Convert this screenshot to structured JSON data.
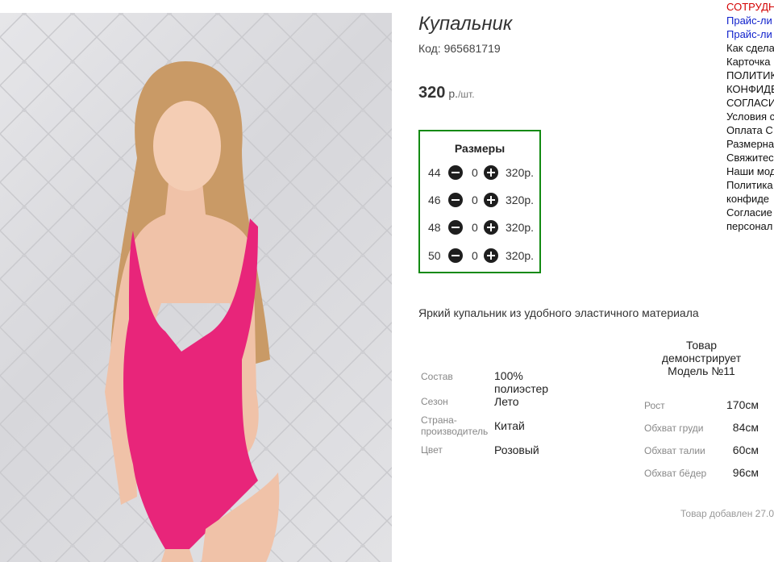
{
  "product": {
    "title": "Купальник",
    "code": "Код: 965681719",
    "price": "320",
    "currency": "р.",
    "unit": "/шт.",
    "sizes_title": "Размеры",
    "sizes": [
      {
        "size": "44",
        "qty": "0",
        "price": "320р."
      },
      {
        "size": "46",
        "qty": "0",
        "price": "320р."
      },
      {
        "size": "48",
        "qty": "0",
        "price": "320р."
      },
      {
        "size": "50",
        "qty": "0",
        "price": "320р."
      }
    ],
    "description": "Яркий купальник из удобного эластичного материала",
    "properties": [
      {
        "key": "Состав",
        "value": "100% полиэстер"
      },
      {
        "key": "Сезон",
        "value": "Лето"
      },
      {
        "key": "Страна-производитель",
        "value": "Китай"
      },
      {
        "key": "Цвет",
        "value": "Розовый"
      }
    ],
    "model_title": "Товар демонстрирует Модель №11",
    "model_params": [
      {
        "key": "Рост",
        "value": "170см"
      },
      {
        "key": "Обхват груди",
        "value": "84см"
      },
      {
        "key": "Обхват талии",
        "value": "60см"
      },
      {
        "key": "Обхват бёдер",
        "value": "96см"
      }
    ],
    "added": "Товар добавлен 27.0"
  },
  "sidebar": {
    "links": [
      {
        "text": "СОТРУДН",
        "color": "#d40000"
      },
      {
        "text": "Прайс-ли",
        "color": "#1122cc"
      },
      {
        "text": "Прайс-ли",
        "color": "#1122cc"
      },
      {
        "text": "Как сдела",
        "color": "#111111"
      },
      {
        "text": "Карточка",
        "color": "#111111"
      },
      {
        "text": "ПОЛИТИК",
        "color": "#111111"
      },
      {
        "text": "КОНФИДЕ",
        "color": "#111111"
      },
      {
        "text": "СОГЛАСИ",
        "color": "#111111"
      },
      {
        "text": "Условия с",
        "color": "#111111"
      },
      {
        "text": "Оплата С",
        "color": "#111111"
      },
      {
        "text": "Размерна",
        "color": "#111111"
      },
      {
        "text": "Свяжитес",
        "color": "#111111"
      },
      {
        "text": "Наши мод",
        "color": "#111111"
      },
      {
        "text": "Политика",
        "color": "#111111"
      },
      {
        "text": "конфиде",
        "color": "#111111"
      },
      {
        "text": "Согласие",
        "color": "#111111"
      },
      {
        "text": "персонал",
        "color": "#111111"
      }
    ]
  },
  "colors": {
    "accent_border": "#128a12",
    "swimsuit": "#e8257a"
  }
}
